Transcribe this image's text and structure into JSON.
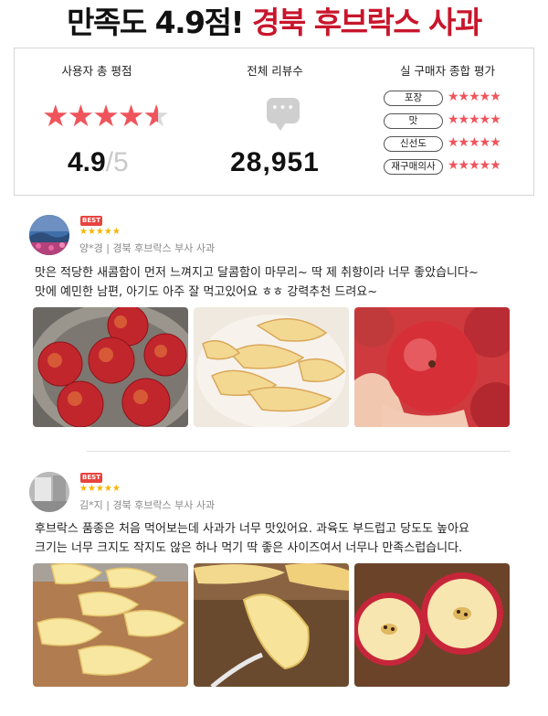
{
  "headline": {
    "part1": "만족도 4.9점! ",
    "part2": "경북 후브락스 사과"
  },
  "summary": {
    "rating_title": "사용자 총 평점",
    "rating_value": "4.9",
    "rating_max": "/5",
    "rating_fraction": 0.98,
    "reviews_title": "전체 리뷰수",
    "reviews_count": "28,951",
    "eval_title": "실 구매자 종합 평가",
    "evaluations": [
      {
        "label": "포장",
        "stars": 5
      },
      {
        "label": "맛",
        "stars": 5
      },
      {
        "label": "신선도",
        "stars": 5
      },
      {
        "label": "재구매의사",
        "stars": 5
      }
    ]
  },
  "reviews": [
    {
      "badge": "BEST",
      "stars": 5,
      "meta": "양*경 | 경북 후브락스 부사 사과",
      "lines": [
        "맛은 적당한 새콤함이 먼저 느껴지고 달콤함이 마무리~ 딱 제 취향이라 너무 좋았습니다~",
        "맛에 예민한 남편, 아기도 아주 잘 먹고있어요 ㅎㅎ 강력추천 드려요~"
      ]
    },
    {
      "badge": "BEST",
      "stars": 5,
      "meta": "김*지 | 경북 후브락스 부사 사과",
      "lines": [
        "후브락스 품종은 처음 먹어보는데 사과가 너무 맛있어요. 과육도 부드럽고 당도도 높아요",
        "크기는 너무 크지도 작지도 않은 하나 먹기 딱 좋은 사이즈여서 너무나 만족스럽습니다."
      ]
    }
  ],
  "colors": {
    "accent_red": "#c8162c",
    "star_red": "#f0545b",
    "star_gold": "#f7b500"
  }
}
